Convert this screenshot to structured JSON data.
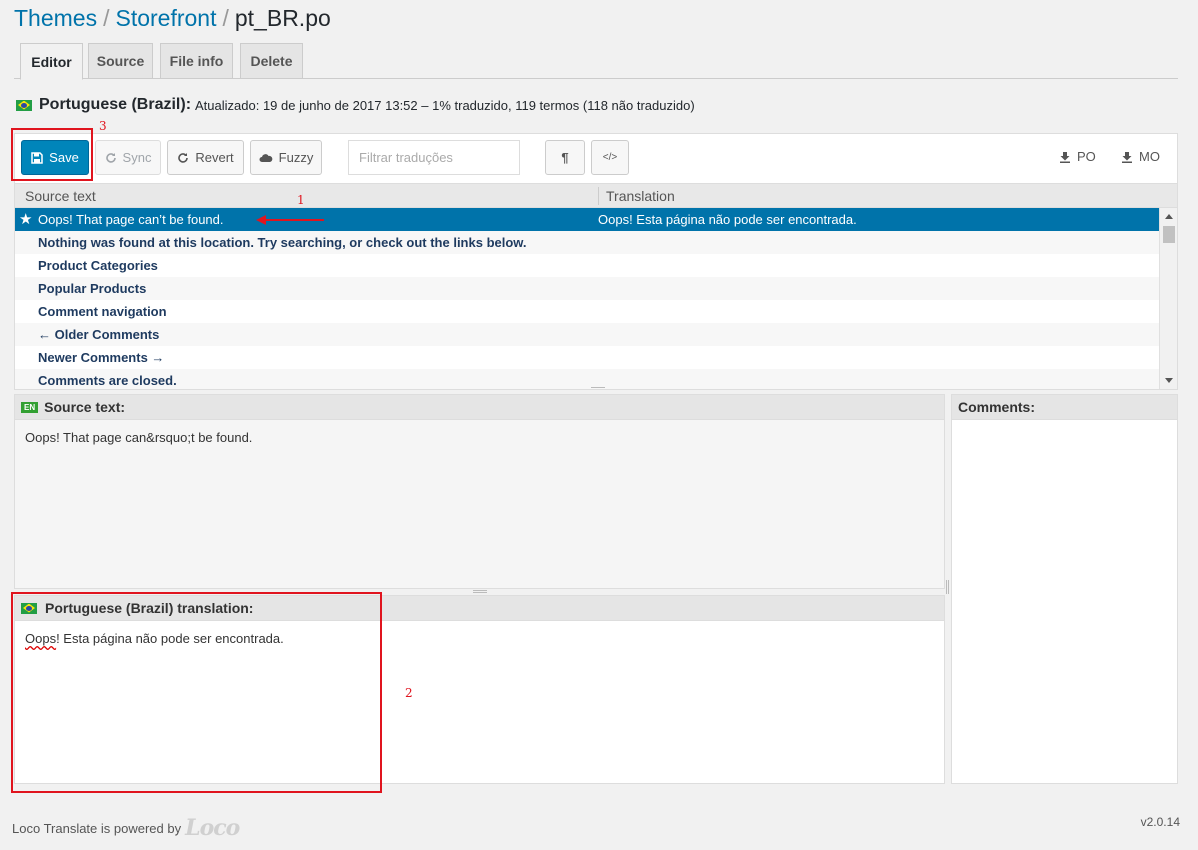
{
  "breadcrumb": {
    "items": [
      "Themes",
      "Storefront"
    ],
    "current": "pt_BR.po",
    "separator": "/"
  },
  "tabs": [
    {
      "label": "Editor",
      "active": true
    },
    {
      "label": "Source",
      "active": false
    },
    {
      "label": "File info",
      "active": false
    },
    {
      "label": "Delete",
      "active": false
    }
  ],
  "language": {
    "name": "Portuguese (Brazil):",
    "meta": "Atualizado: 19 de junho de 2017 13:52 – 1% traduzido, 119 termos (118 não traduzido)"
  },
  "toolbar": {
    "save": "Save",
    "sync": "Sync",
    "revert": "Revert",
    "fuzzy": "Fuzzy",
    "filter_placeholder": "Filtrar traduções",
    "pilcrow": "¶",
    "code": "</>",
    "po": "PO",
    "mo": "MO"
  },
  "grid": {
    "col_source": "Source text",
    "col_translation": "Translation",
    "rows": [
      {
        "source": "Oops! That page can’t be found.",
        "translation": "Oops! Esta página não pode ser encontrada.",
        "selected": true
      },
      {
        "source": "Nothing was found at this location. Try searching, or check out the links below.",
        "translation": ""
      },
      {
        "source": "Product Categories",
        "translation": ""
      },
      {
        "source": "Popular Products",
        "translation": ""
      },
      {
        "source": "Comment navigation",
        "translation": ""
      },
      {
        "source": "← Older Comments",
        "translation": ""
      },
      {
        "source": "Newer Comments →",
        "translation": ""
      },
      {
        "source": "Comments are closed.",
        "translation": ""
      }
    ]
  },
  "source_pane": {
    "badge": "EN",
    "title": "Source text:",
    "text": "Oops! That page can&rsquo;t be found."
  },
  "comments_pane": {
    "title": "Comments:"
  },
  "translation_pane": {
    "title": "Portuguese (Brazil) translation:",
    "text_first": "Oops",
    "text_rest": "! Esta página não pode ser encontrada."
  },
  "annotations": {
    "n1": "1",
    "n2": "2",
    "n3": "3",
    "color": "#e0141e"
  },
  "footer": {
    "powered": "Loco Translate is powered by",
    "logo": "Loco",
    "version": "v2.0.14"
  },
  "colors": {
    "link": "#0073aa",
    "primary": "#0085ba",
    "selected_row": "#0073aa"
  }
}
